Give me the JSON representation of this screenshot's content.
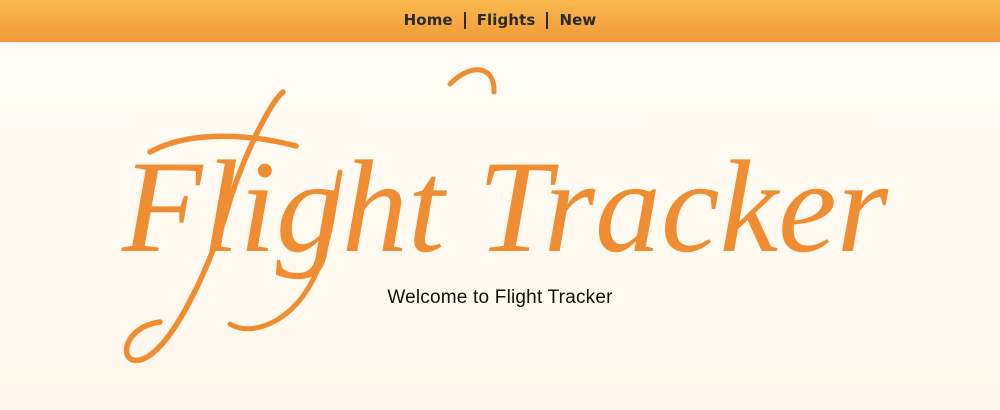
{
  "nav": {
    "items": [
      {
        "label": "Home"
      },
      {
        "label": "Flights"
      },
      {
        "label": "New"
      }
    ]
  },
  "hero": {
    "title": "Flight Tracker",
    "welcome": "Welcome to Flight Tracker"
  },
  "colors": {
    "nav_gradient_top": "#f8b94e",
    "nav_gradient_bottom": "#f29a39",
    "title_color": "#f08d33",
    "background": "#fffdf8",
    "text_color": "#111111"
  }
}
